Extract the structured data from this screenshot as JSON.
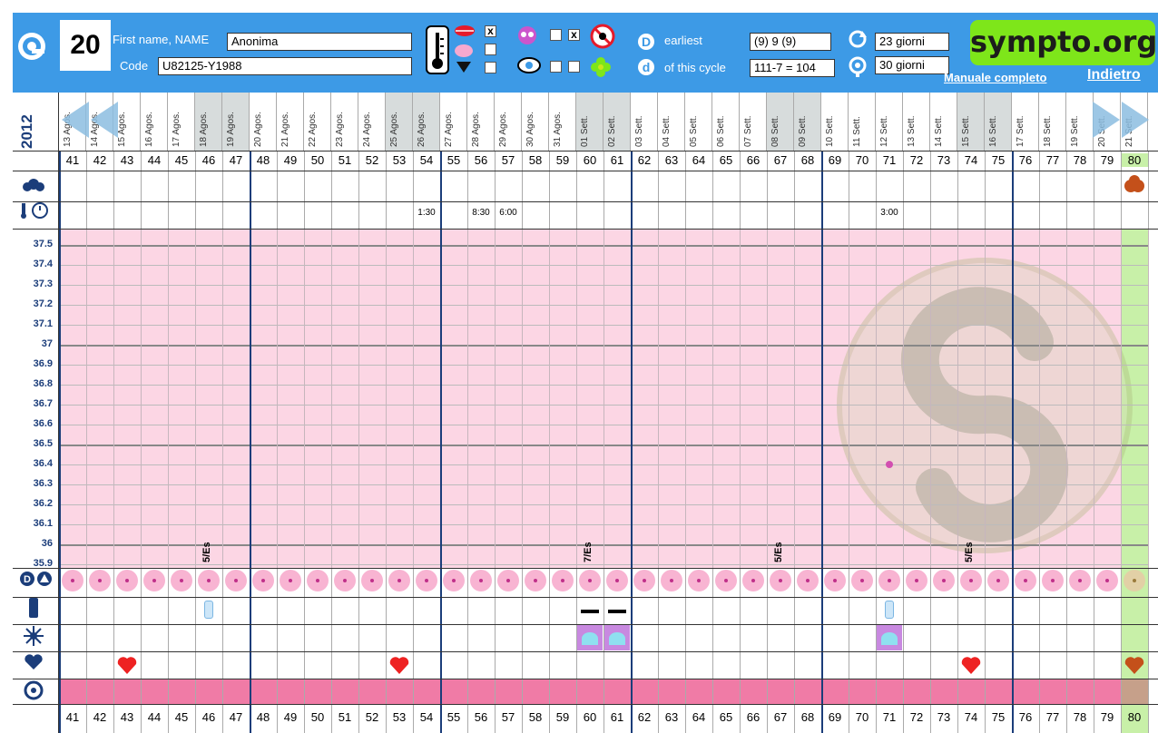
{
  "header": {
    "cycle_number": "20",
    "name_label": "First name, NAME",
    "name_value": "Anonima",
    "code_label": "Code",
    "code_value": "U82125-Y1988",
    "x_mark": "x",
    "earliest_label": "earliest",
    "earliest_value": "(9) 9 (9)",
    "this_cycle_label": "of this cycle",
    "this_cycle_value": "111-7 = 104",
    "days_1": "23 giorni",
    "days_2": "30 giorni",
    "logo": "sympto.org",
    "manual_link": "Manuale completo",
    "back_link": "Indietro"
  },
  "year": "2012",
  "dates": [
    "13 Agos.",
    "14 Agos.",
    "15 Agos.",
    "16 Agos.",
    "17 Agos.",
    "18 Agos.",
    "19 Agos.",
    "20 Agos.",
    "21 Agos.",
    "22 Agos.",
    "23 Agos.",
    "24 Agos.",
    "25 Agos.",
    "26 Agos.",
    "27 Agos.",
    "28 Agos.",
    "29 Agos.",
    "30 Agos.",
    "31 Agos.",
    "01 Sett.",
    "02 Sett.",
    "03 Sett.",
    "04 Sett.",
    "05 Sett.",
    "06 Sett.",
    "07 Sett.",
    "08 Sett.",
    "09 Sett.",
    "10 Sett.",
    "11 Sett.",
    "12 Sett.",
    "13 Sett.",
    "14 Sett.",
    "15 Sett.",
    "16 Sett.",
    "17 Sett.",
    "18 Sett.",
    "19 Sett.",
    "20 Sett.",
    "21 Sett."
  ],
  "weekend_dates": [
    "18 Agos.",
    "19 Agos.",
    "25 Agos.",
    "26 Agos.",
    "01 Sett.",
    "02 Sett.",
    "08 Sett.",
    "09 Sett.",
    "15 Sett.",
    "16 Sett."
  ],
  "cycle_days": [
    41,
    42,
    43,
    44,
    45,
    46,
    47,
    48,
    49,
    50,
    51,
    52,
    53,
    54,
    55,
    56,
    57,
    58,
    59,
    60,
    61,
    62,
    63,
    64,
    65,
    66,
    67,
    68,
    69,
    70,
    71,
    72,
    73,
    74,
    75,
    76,
    77,
    78,
    79,
    80
  ],
  "times": [
    {
      "day": 54,
      "text": "1:30"
    },
    {
      "day": 56,
      "text": "8:30"
    },
    {
      "day": 57,
      "text": "6:00"
    },
    {
      "day": 71,
      "text": "3:00"
    }
  ],
  "temp_labels": [
    "37.5",
    "37.4",
    "37.3",
    "37.2",
    "37.1",
    "37",
    "36.9",
    "36.8",
    "36.7",
    "36.6",
    "36.5",
    "36.4",
    "36.3",
    "36.2",
    "36.1",
    "36",
    "35.9"
  ],
  "temperature_points": [
    {
      "day": 71,
      "temp": 36.4
    }
  ],
  "annotations": [
    {
      "day": 46,
      "text": "5/Es"
    },
    {
      "day": 60,
      "text": "7/Es"
    },
    {
      "day": 67,
      "text": "5/Es"
    },
    {
      "day": 74,
      "text": "5/Es"
    }
  ],
  "hearts": [
    43,
    53,
    74,
    80
  ],
  "cervix_days": [
    46,
    71
  ],
  "mucus_days": [
    60,
    61,
    71
  ],
  "dash_days": [
    60,
    61
  ],
  "colors": {
    "header_bg": "#3d9ae6",
    "chart_pink": "#fcd6e4",
    "last_day_green": "#c8f0a8",
    "logo_green": "#7ee61a",
    "bottom_band": "#f07ba6",
    "heart": "#ee2222",
    "point": "#d24fb0"
  }
}
